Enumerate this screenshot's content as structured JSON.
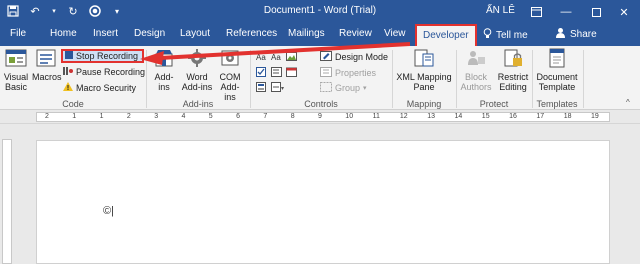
{
  "app": {
    "document_title": "Document1 - Word (Trial)",
    "user_name": "ẤN LÊ"
  },
  "tabs": [
    {
      "label": "File"
    },
    {
      "label": "Home"
    },
    {
      "label": "Insert"
    },
    {
      "label": "Design"
    },
    {
      "label": "Layout"
    },
    {
      "label": "References"
    },
    {
      "label": "Mailings"
    },
    {
      "label": "Review"
    },
    {
      "label": "View"
    },
    {
      "label": "Developer",
      "active": true
    }
  ],
  "tell_me": "Tell me",
  "share": "Share",
  "ribbon": {
    "code": {
      "label": "Code",
      "visual_basic": "Visual Basic",
      "macros": "Macros",
      "stop_recording": "Stop Recording",
      "pause_recording": "Pause Recording",
      "macro_security": "Macro Security"
    },
    "addins": {
      "label": "Add-ins",
      "addins": "Add-ins",
      "word_addins": "Word Add-ins",
      "com_addins": "COM Add-ins"
    },
    "controls": {
      "label": "Controls",
      "design_mode": "Design Mode",
      "properties": "Properties",
      "group": "Group"
    },
    "mapping": {
      "label": "Mapping",
      "xml_mapping_pane": "XML Mapping Pane"
    },
    "protect": {
      "label": "Protect",
      "block_authors": "Block Authors",
      "restrict_editing": "Restrict Editing"
    },
    "templates": {
      "label": "Templates",
      "document_template": "Document Template"
    }
  },
  "ruler": {
    "numbers": [
      "2",
      "1",
      "1",
      "2",
      "3",
      "4",
      "5",
      "6",
      "7",
      "8",
      "9",
      "10",
      "11",
      "12",
      "13",
      "14",
      "15",
      "16",
      "17",
      "18",
      "19"
    ]
  },
  "colors": {
    "title_bar": "#2b579a",
    "highlight": "#e2322f",
    "ribbon": "#f3f3f3"
  }
}
